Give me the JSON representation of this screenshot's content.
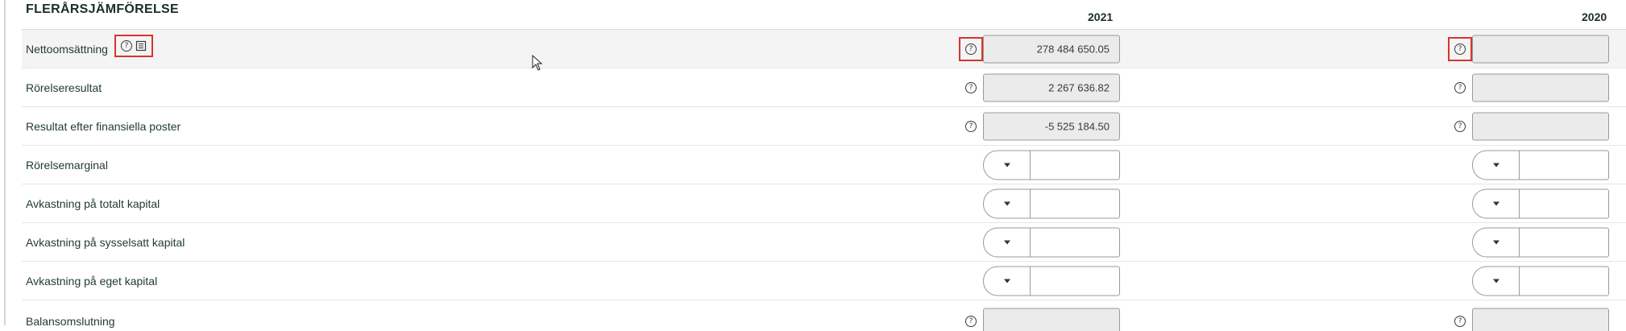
{
  "section": {
    "title": "FLERÅRSJÄMFÖRELSE"
  },
  "years": [
    "2021",
    "2020"
  ],
  "rows": [
    {
      "label": "Nettoomsättning",
      "type": "amount",
      "value_2021": "278 484 650.05",
      "value_2020": ""
    },
    {
      "label": "Rörelseresultat",
      "type": "amount",
      "value_2021": "2 267 636.82",
      "value_2020": ""
    },
    {
      "label": "Resultat efter finansiella poster",
      "type": "amount",
      "value_2021": "-5 525 184.50",
      "value_2020": ""
    },
    {
      "label": "Rörelsemarginal",
      "type": "combo",
      "value_2021": "",
      "value_2020": ""
    },
    {
      "label": "Avkastning på totalt kapital",
      "type": "combo",
      "value_2021": "",
      "value_2020": ""
    },
    {
      "label": "Avkastning på sysselsatt kapital",
      "type": "combo",
      "value_2021": "",
      "value_2020": ""
    },
    {
      "label": "Avkastning på eget kapital",
      "type": "combo",
      "value_2021": "",
      "value_2020": ""
    },
    {
      "label": "Balansomslutning",
      "type": "amount",
      "value_2021": "",
      "value_2020": ""
    }
  ],
  "icons": {
    "help": "question-circle-icon",
    "document": "document-icon",
    "dropdown": "caret-down-icon",
    "cursor": "mouse-pointer"
  },
  "colors": {
    "highlight_border": "#d9342b",
    "field_bg": "#ebebeb",
    "row_highlight_bg": "#f4f4f4"
  }
}
